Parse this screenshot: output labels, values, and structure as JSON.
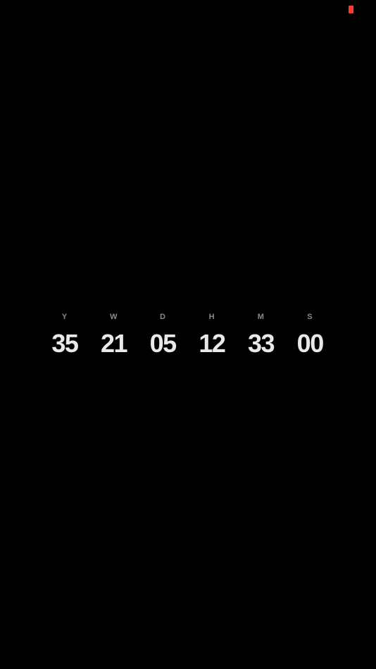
{
  "status": {
    "indicator_color": "#ff3b30",
    "indicator_icon": "recording-indicator-icon"
  },
  "countdown": {
    "units": [
      {
        "label": "Y",
        "value": "35"
      },
      {
        "label": "W",
        "value": "21"
      },
      {
        "label": "D",
        "value": "05"
      },
      {
        "label": "H",
        "value": "12"
      },
      {
        "label": "M",
        "value": "33"
      },
      {
        "label": "S",
        "value": "00"
      }
    ]
  }
}
